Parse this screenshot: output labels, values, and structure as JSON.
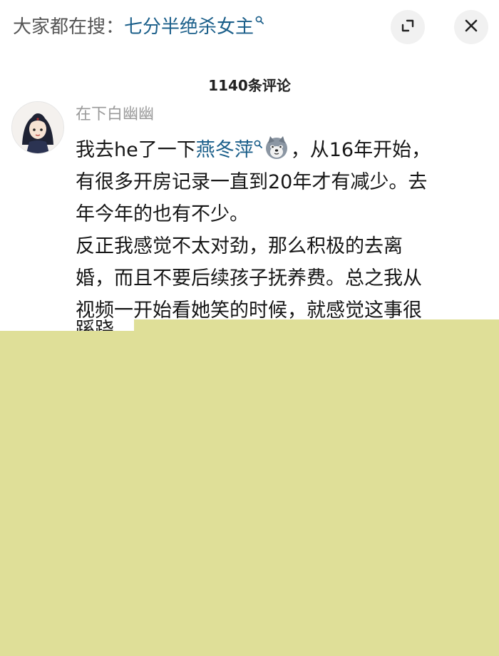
{
  "search_bar": {
    "prefix": "大家都在搜：",
    "query": "七分半绝杀女主",
    "query_icon": "search-icon"
  },
  "controls": {
    "expand_icon": "expand-icon",
    "close_icon": "close-icon"
  },
  "comments_header": {
    "count_label": "1140条评论"
  },
  "comment": {
    "avatar_icon": "avatar-anime-character",
    "username": "在下白幽幽",
    "line1_pre": "我去he了一下",
    "mention": "燕冬萍",
    "mention_icon": "search-icon",
    "emoji": "husky-dog-emoji",
    "line1_post": "，从16年开始，",
    "lines": [
      "有很多开房记录一直到20年才有减少。去",
      "年今年的也有不少。",
      "反正我感觉不太对劲，那么积极的去离",
      "婚，而且不要后续孩子抚养费。总之我从",
      "视频一开始看她笑的时候，就感觉这事很"
    ],
    "cut_line": "蹊跷"
  },
  "overlay": {
    "color": "#dfdf98"
  }
}
